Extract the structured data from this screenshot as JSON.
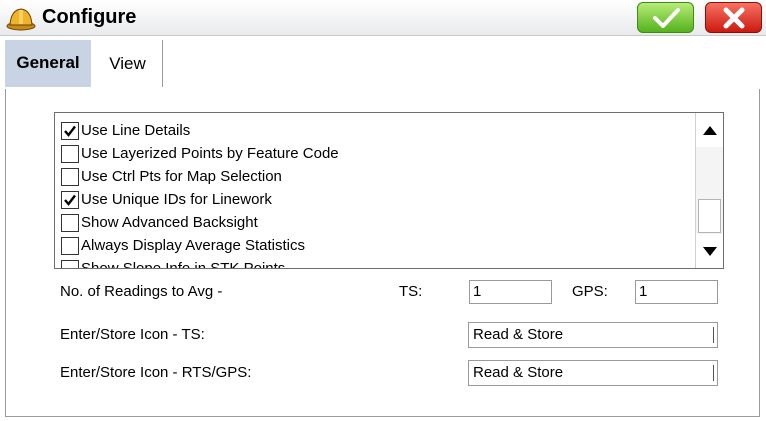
{
  "window": {
    "title": "Configure",
    "icon": "hard-hat-icon",
    "ok_icon": "check-icon",
    "close_icon": "x-icon",
    "colors": {
      "ok": "#55b21c",
      "close": "#cc1a10",
      "active_tab": "#c8d4e3"
    }
  },
  "tabs": [
    {
      "label": "General",
      "active": true
    },
    {
      "label": "View",
      "active": false
    }
  ],
  "options": [
    {
      "label": "Use Line Details",
      "checked": true
    },
    {
      "label": "Use Layerized Points by Feature Code",
      "checked": false
    },
    {
      "label": "Use Ctrl Pts for Map Selection",
      "checked": false
    },
    {
      "label": "Use Unique IDs for Linework",
      "checked": true
    },
    {
      "label": "Show Advanced Backsight",
      "checked": false
    },
    {
      "label": "Always Display Average Statistics",
      "checked": false
    },
    {
      "label": "Show Slope Info in STK Points",
      "checked": false
    }
  ],
  "readings": {
    "label": "No. of Readings to Avg  -",
    "ts_label": "TS:",
    "ts_value": "1",
    "gps_label": "GPS:",
    "gps_value": "1"
  },
  "icon_ts": {
    "label": "Enter/Store Icon - TS:",
    "value": "Read & Store"
  },
  "icon_rts": {
    "label": "Enter/Store Icon - RTS/GPS:",
    "value": "Read & Store"
  }
}
